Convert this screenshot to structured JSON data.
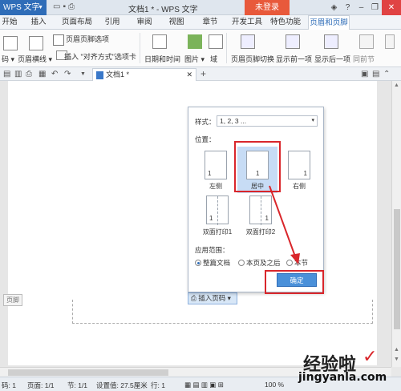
{
  "titlebar": {
    "app_name": "WPS 文字",
    "doc_title": "文档1 * - WPS 文字",
    "login_label": "未登录"
  },
  "menu": {
    "tabs": [
      "开始",
      "插入",
      "页面布局",
      "引用",
      "审阅",
      "视图",
      "章节",
      "开发工具",
      "特色功能",
      "页眉和页脚"
    ],
    "active": "页眉和页脚"
  },
  "ribbon": {
    "items": {
      "header_footer_options": "页眉页脚选项",
      "page_number": "码",
      "header_line": "页眉横线",
      "insert": "插入",
      "align_tab": "\"对齐方式\"选项卡",
      "date_time": "日期和时间",
      "picture": "图片",
      "field": "域",
      "switch": "页眉页脚切换",
      "show_prev": "显示前一项",
      "show_next": "显示后一项",
      "same_as_prev": "同前节"
    }
  },
  "doc": {
    "tab_label": "文档1 *",
    "footer_label": "页脚",
    "insert_page_number": "插入页码"
  },
  "popup": {
    "style_label": "样式：",
    "style_value": "1, 2, 3 ...",
    "position_label": "位置：",
    "positions": [
      {
        "label": "左侧",
        "num": "1"
      },
      {
        "label": "居中",
        "num": "1"
      },
      {
        "label": "右侧",
        "num": "1"
      },
      {
        "label": "双面打印1",
        "num": "1"
      },
      {
        "label": "双面打印2",
        "num": "1"
      }
    ],
    "selected_position": "居中",
    "scope_label": "应用范围：",
    "scope_options": [
      "整篇文档",
      "本页及之后",
      "本节"
    ],
    "selected_scope": "整篇文档",
    "ok_label": "确定"
  },
  "status": {
    "page_num": "码: 1",
    "pages": "页面: 1/1",
    "section": "节: 1/1",
    "setting": "设置值: 27.5厘米",
    "row": "行: 1",
    "zoom": "100 %"
  },
  "watermark": {
    "main": "经验啦",
    "sub": "jingyanla.com",
    "check": "✓"
  },
  "colors": {
    "accent": "#2f6db8",
    "login": "#e8593b",
    "highlight_red": "#d9262b",
    "selection": "#c7dcf5"
  }
}
